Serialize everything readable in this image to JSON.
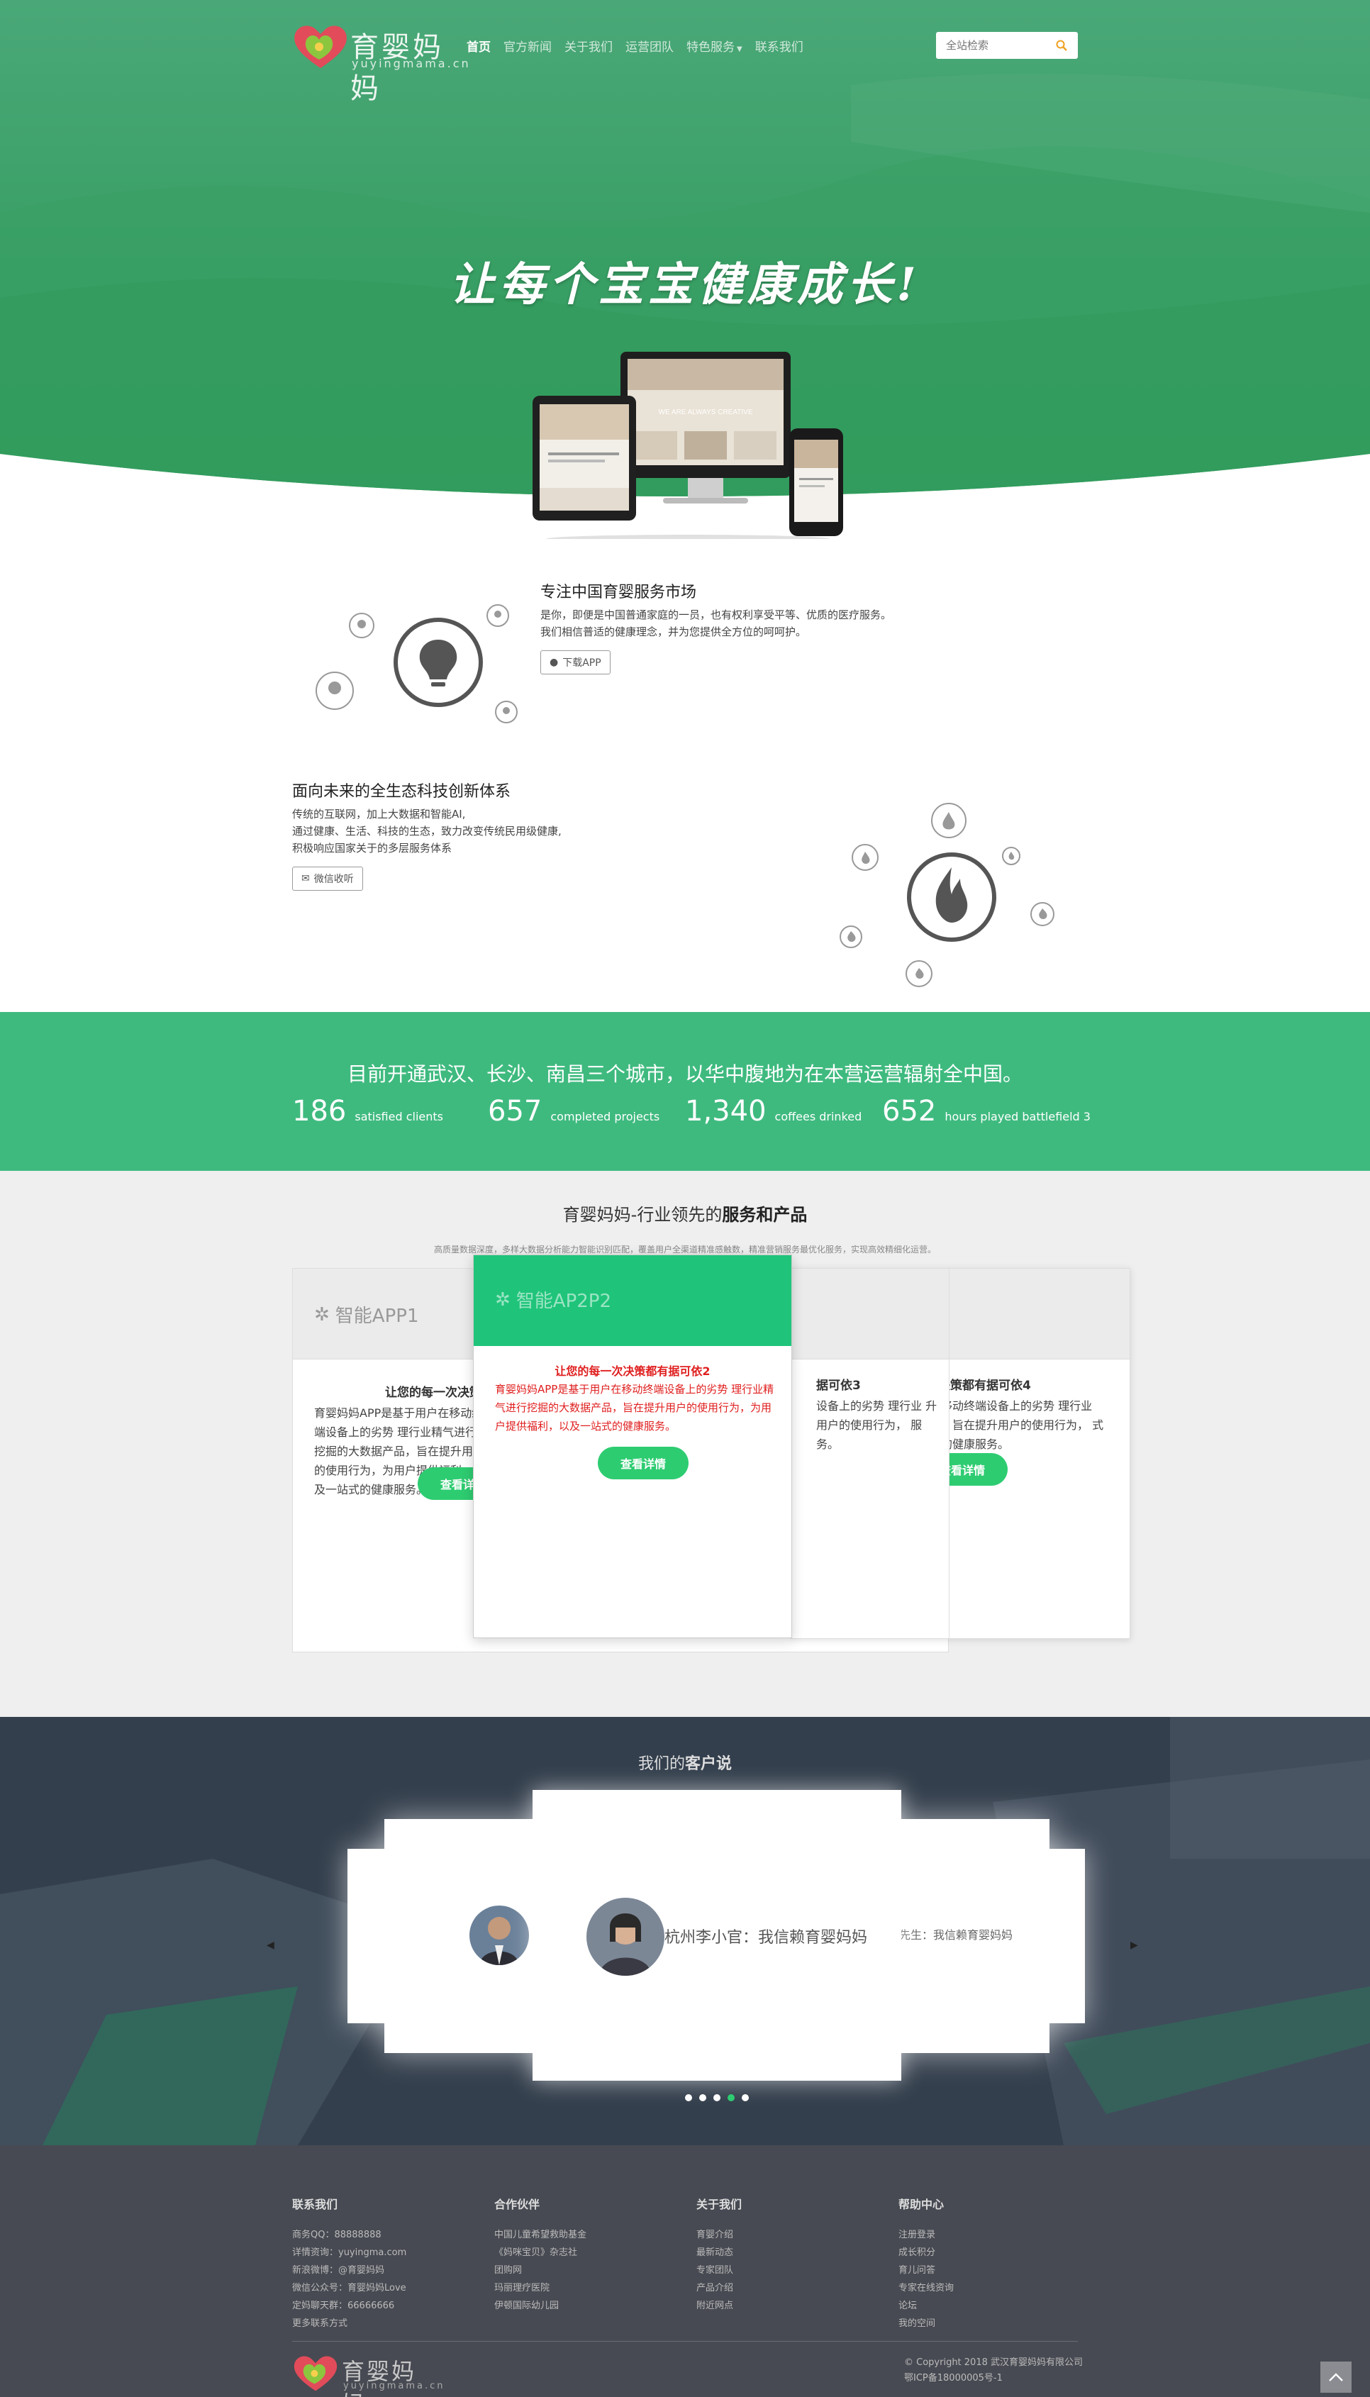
{
  "nav": {
    "logo_text": "育婴妈妈",
    "logo_sub": "yuyingmama.cn",
    "items": [
      {
        "label": "首页",
        "active": true
      },
      {
        "label": "官方新闻"
      },
      {
        "label": "关于我们"
      },
      {
        "label": "运营团队"
      },
      {
        "label": "特色服务"
      },
      {
        "label": "联系我们"
      }
    ],
    "search_placeholder": "全站检索"
  },
  "hero": {
    "slogan": "让每个宝宝健康成长!",
    "device_text": "WE ARE ALWAYS CREATIVE"
  },
  "feature1": {
    "title": "专注中国育婴服务市场",
    "text1": "是你，即便是中国普通家庭的一员，也有权利享受平等、优质的医疗服务。",
    "text2": "我们相信普适的健康理念，并为您提供全方位的呵呵护。",
    "button": "下载APP"
  },
  "feature2": {
    "title": "面向未来的全生态科技创新体系",
    "text1": "传统的互联网，加上大数据和智能AI,",
    "text2": "通过健康、生活、科技的生态，致力改变传统民用级健康,",
    "text3": "积极响应国家关于的多层服务体系",
    "button": "微信收听"
  },
  "stats": {
    "title": "目前开通武汉、长沙、南昌三个城市，以华中腹地为在本营运营辐射全中国。",
    "items": [
      {
        "num": "186",
        "label": "satisfied clients"
      },
      {
        "num": "657",
        "label": "completed projects"
      },
      {
        "num": "1,340",
        "label": "coffees drinked"
      },
      {
        "num": "652",
        "label": "hours played battlefield 3"
      }
    ]
  },
  "services": {
    "title_pre": "育婴妈妈-行业领先的",
    "title_bold": "服务和产品",
    "subtitle": "高质量数据深度，多样大数据分析能力智能识别匹配，覆盖用户全渠道精准感触数，精准营销服务最优化服务，实现高效精细化运营。",
    "card1": {
      "head": "智能APP1",
      "title": "让您的每一次决策都有据可依1",
      "text": "育婴妈妈APP是基于用户在移动终端设备上的劣势 理行业精气进行挖掘的大数据产品，旨在提升用户的使用行为，为用户提供福利，以及一站式的健康服务。",
      "button": "查看详情"
    },
    "card2": {
      "head": "智能AP2P2",
      "title": "让您的每一次决策都有据可依2",
      "text": "育婴妈妈APP是基于用户在移动终端设备上的劣势 理行业精气进行挖掘的大数据产品，旨在提升用户的使用行为，为用户提供福利，以及一站式的健康服务。",
      "button": "查看详情"
    },
    "card3": {
      "title": "据可依3",
      "text": "设备上的劣势 理行业 升用户的使用行为， 服务。"
    },
    "card4": {
      "title": "决策都有据可依4",
      "text": "移动终端设备上的劣势 理行业 ，旨在提升用户的使用行为， 式的健康服务。",
      "button": "查看详情"
    }
  },
  "testimonials": {
    "title_pre": "我们的",
    "title_bold": "客户说",
    "main_quote": "杭州李小官：我信赖育婴妈妈",
    "side_quote": "先生：我信赖育婴妈妈",
    "active_dot": 3
  },
  "footer": {
    "columns": [
      {
        "title": "联系我们",
        "items": [
          "商务QQ：88888888",
          "详情资询：yuyingma.com",
          "新浪微博：@育婴妈妈",
          "微信公众号：育婴妈妈Love",
          "定妈聊天群：66666666",
          "更多联系方式"
        ]
      },
      {
        "title": "合作伙伴",
        "items": [
          "中国儿童希望救助基金",
          "《妈咪宝贝》杂志社",
          "团购网",
          "玛丽理疗医院",
          "伊顿国际幼儿园"
        ]
      },
      {
        "title": "关于我们",
        "items": [
          "育婴介绍",
          "最新动态",
          "专家团队",
          "产品介绍",
          "附近网点"
        ]
      },
      {
        "title": "帮助中心",
        "items": [
          "注册登录",
          "成长积分",
          "育儿问答",
          "专家在线资询",
          "论坛",
          "我的空间"
        ]
      }
    ],
    "logo_text": "育婴妈妈",
    "logo_sub": "yuyingmama.cn",
    "copyright": "© Copyright 2018 武汉育婴妈妈有限公司",
    "icp": "鄂ICP备18000005号-1"
  },
  "colors": {
    "brand_green": "#3fba7f",
    "button_green": "#2ecc71",
    "alert_red": "#e02020",
    "footer_bg": "#474a52"
  }
}
